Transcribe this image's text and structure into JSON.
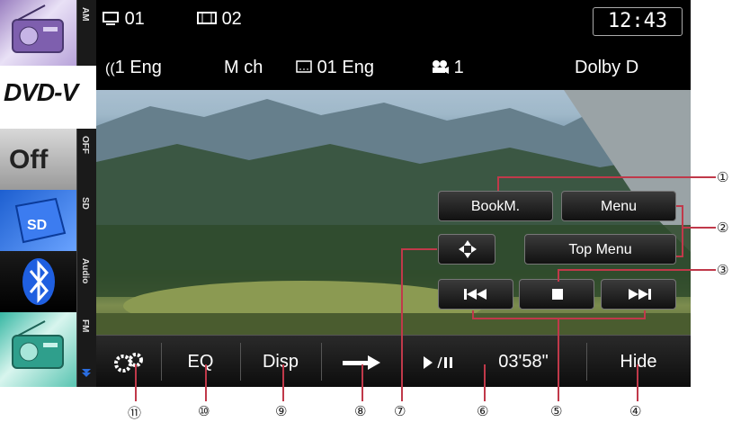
{
  "sources": [
    {
      "name": "am",
      "label": "AM"
    },
    {
      "name": "dvd",
      "label": "DVD-V"
    },
    {
      "name": "off",
      "label": "OFF",
      "tile_text": "Off"
    },
    {
      "name": "sd",
      "label": "SD"
    },
    {
      "name": "bt",
      "label": "Audio"
    },
    {
      "name": "fm",
      "label": "FM"
    }
  ],
  "info": {
    "title_num": "01",
    "chapter_num": "02",
    "audio": "1 Eng",
    "channels": "M ch",
    "subtitle": "01 Eng",
    "angle": "1",
    "format": "Dolby D",
    "clock": "12:43"
  },
  "buttons": {
    "bookmark": "BookM.",
    "menu": "Menu",
    "top_menu": "Top Menu"
  },
  "bottom": {
    "eq": "EQ",
    "disp": "Disp",
    "time": "03'58\"",
    "hide": "Hide"
  },
  "callouts": {
    "n1": "①",
    "n2": "②",
    "n3": "③",
    "n4": "④",
    "n5": "⑤",
    "n6": "⑥",
    "n7": "⑦",
    "n8": "⑧",
    "n9": "⑨",
    "n10": "⑩",
    "n11": "⑪"
  },
  "colors": {
    "callout": "#c0394a",
    "button_bg": "#111111",
    "accent_blue": "#2a6de0"
  }
}
